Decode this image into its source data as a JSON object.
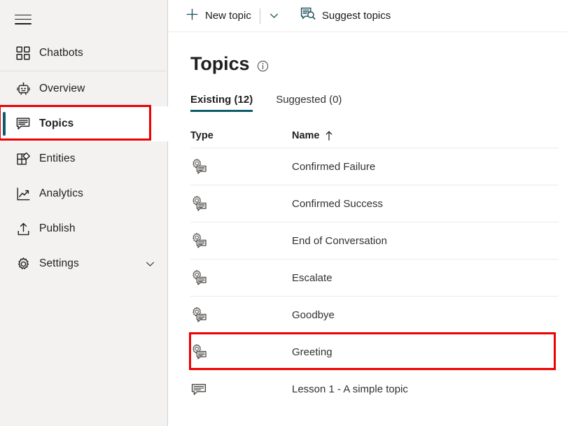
{
  "sidebar": {
    "menu_icon": "hamburger-icon",
    "items": [
      {
        "label": "Chatbots",
        "icon": "grid-squares-icon",
        "active": false,
        "has_chevron": false
      },
      {
        "label": "Overview",
        "icon": "robot-icon",
        "active": false,
        "has_chevron": false
      },
      {
        "label": "Topics",
        "icon": "speech-bubble-filled-icon",
        "active": true,
        "has_chevron": false
      },
      {
        "label": "Entities",
        "icon": "entities-grid-icon",
        "active": false,
        "has_chevron": false
      },
      {
        "label": "Analytics",
        "icon": "line-chart-icon",
        "active": false,
        "has_chevron": false
      },
      {
        "label": "Publish",
        "icon": "upload-icon",
        "active": false,
        "has_chevron": false
      },
      {
        "label": "Settings",
        "icon": "gear-icon",
        "active": true,
        "has_chevron": true
      }
    ]
  },
  "commandbar": {
    "new_topic_label": "New topic",
    "new_topic_icon": "plus-icon",
    "new_topic_chevron_icon": "chevron-down-icon",
    "suggest_topics_label": "Suggest topics",
    "suggest_topics_icon": "suggest-topics-icon"
  },
  "page": {
    "title": "Topics",
    "info_icon": "info-circle-icon"
  },
  "tabs": [
    {
      "label": "Existing (12)",
      "active": true
    },
    {
      "label": "Suggested (0)",
      "active": false
    }
  ],
  "table": {
    "columns": [
      {
        "label": "Type",
        "sort": ""
      },
      {
        "label": "Name",
        "sort": "↑"
      }
    ],
    "rows": [
      {
        "type_icon": "system-topic-icon",
        "name": "Confirmed Failure",
        "highlighted": false
      },
      {
        "type_icon": "system-topic-icon",
        "name": "Confirmed Success",
        "highlighted": false
      },
      {
        "type_icon": "system-topic-icon",
        "name": "End of Conversation",
        "highlighted": false
      },
      {
        "type_icon": "system-topic-icon",
        "name": "Escalate",
        "highlighted": false
      },
      {
        "type_icon": "system-topic-icon",
        "name": "Goodbye",
        "highlighted": false
      },
      {
        "type_icon": "system-topic-icon",
        "name": "Greeting",
        "highlighted": true
      },
      {
        "type_icon": "user-topic-icon",
        "name": "Lesson 1 - A simple topic",
        "highlighted": false
      }
    ]
  },
  "annotations": {
    "highlight_color": "#ef0000",
    "boxes": [
      {
        "target": "sidebar-item-topics"
      },
      {
        "target": "table-row-greeting"
      }
    ]
  },
  "colors": {
    "accent": "#0e5c6b",
    "sidebar_bg": "#f3f2f1",
    "text": "#201f1e"
  }
}
